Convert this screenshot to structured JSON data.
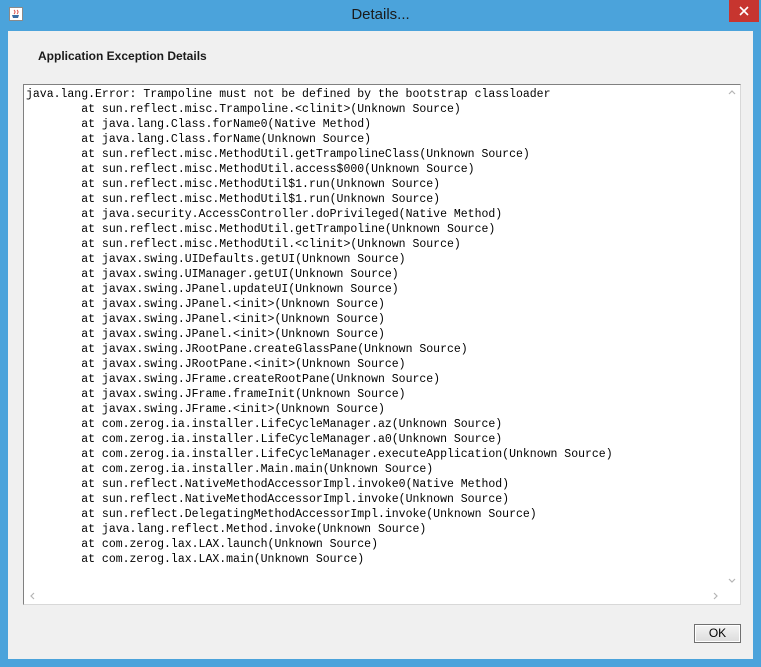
{
  "window": {
    "title": "Details..."
  },
  "header": {
    "label": "Application Exception Details"
  },
  "details": {
    "lines": [
      "java.lang.Error: Trampoline must not be defined by the bootstrap classloader",
      "\tat sun.reflect.misc.Trampoline.<clinit>(Unknown Source)",
      "\tat java.lang.Class.forName0(Native Method)",
      "\tat java.lang.Class.forName(Unknown Source)",
      "\tat sun.reflect.misc.MethodUtil.getTrampolineClass(Unknown Source)",
      "\tat sun.reflect.misc.MethodUtil.access$000(Unknown Source)",
      "\tat sun.reflect.misc.MethodUtil$1.run(Unknown Source)",
      "\tat sun.reflect.misc.MethodUtil$1.run(Unknown Source)",
      "\tat java.security.AccessController.doPrivileged(Native Method)",
      "\tat sun.reflect.misc.MethodUtil.getTrampoline(Unknown Source)",
      "\tat sun.reflect.misc.MethodUtil.<clinit>(Unknown Source)",
      "\tat javax.swing.UIDefaults.getUI(Unknown Source)",
      "\tat javax.swing.UIManager.getUI(Unknown Source)",
      "\tat javax.swing.JPanel.updateUI(Unknown Source)",
      "\tat javax.swing.JPanel.<init>(Unknown Source)",
      "\tat javax.swing.JPanel.<init>(Unknown Source)",
      "\tat javax.swing.JPanel.<init>(Unknown Source)",
      "\tat javax.swing.JRootPane.createGlassPane(Unknown Source)",
      "\tat javax.swing.JRootPane.<init>(Unknown Source)",
      "\tat javax.swing.JFrame.createRootPane(Unknown Source)",
      "\tat javax.swing.JFrame.frameInit(Unknown Source)",
      "\tat javax.swing.JFrame.<init>(Unknown Source)",
      "\tat com.zerog.ia.installer.LifeCycleManager.az(Unknown Source)",
      "\tat com.zerog.ia.installer.LifeCycleManager.a0(Unknown Source)",
      "\tat com.zerog.ia.installer.LifeCycleManager.executeApplication(Unknown Source)",
      "\tat com.zerog.ia.installer.Main.main(Unknown Source)",
      "\tat sun.reflect.NativeMethodAccessorImpl.invoke0(Native Method)",
      "\tat sun.reflect.NativeMethodAccessorImpl.invoke(Unknown Source)",
      "\tat sun.reflect.DelegatingMethodAccessorImpl.invoke(Unknown Source)",
      "\tat java.lang.reflect.Method.invoke(Unknown Source)",
      "\tat com.zerog.lax.LAX.launch(Unknown Source)",
      "\tat com.zerog.lax.LAX.main(Unknown Source)"
    ]
  },
  "buttons": {
    "ok_label": "OK"
  },
  "icons": {
    "app": "java-app-icon",
    "close": "close-icon"
  },
  "colors": {
    "titlebar": "#4ba3db",
    "close_button": "#c7352f",
    "dialog_background": "#f0f0f0"
  }
}
